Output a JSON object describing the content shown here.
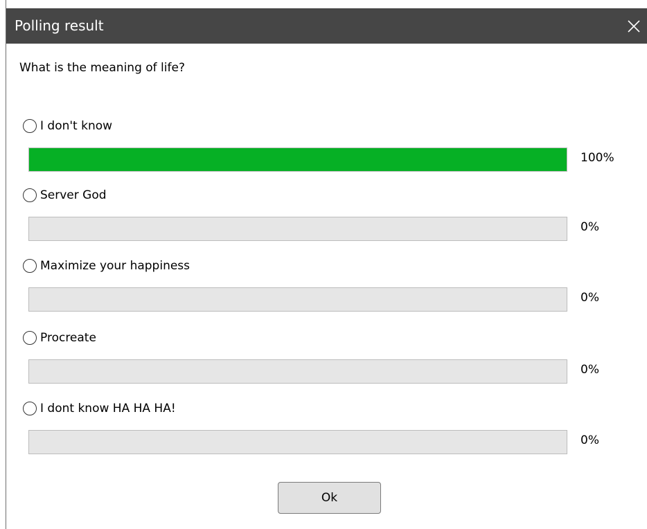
{
  "window": {
    "title": "Polling result"
  },
  "poll": {
    "question": "What is the meaning of life?",
    "options": [
      {
        "label": "I don't know",
        "percent_label": "100%",
        "fraction": 1.0
      },
      {
        "label": "Server God",
        "percent_label": "0%",
        "fraction": 0.0
      },
      {
        "label": "Maximize your happiness",
        "percent_label": "0%",
        "fraction": 0.0
      },
      {
        "label": "Procreate",
        "percent_label": "0%",
        "fraction": 0.0
      },
      {
        "label": "I dont know HA HA HA!",
        "percent_label": "0%",
        "fraction": 0.0
      }
    ]
  },
  "buttons": {
    "ok_label": "Ok"
  },
  "colors": {
    "titlebar": "#464646",
    "bar_fill": "#06b025",
    "bar_track": "#e6e6e6"
  },
  "icons": {
    "close": "close-icon",
    "radio": "radio-button"
  }
}
